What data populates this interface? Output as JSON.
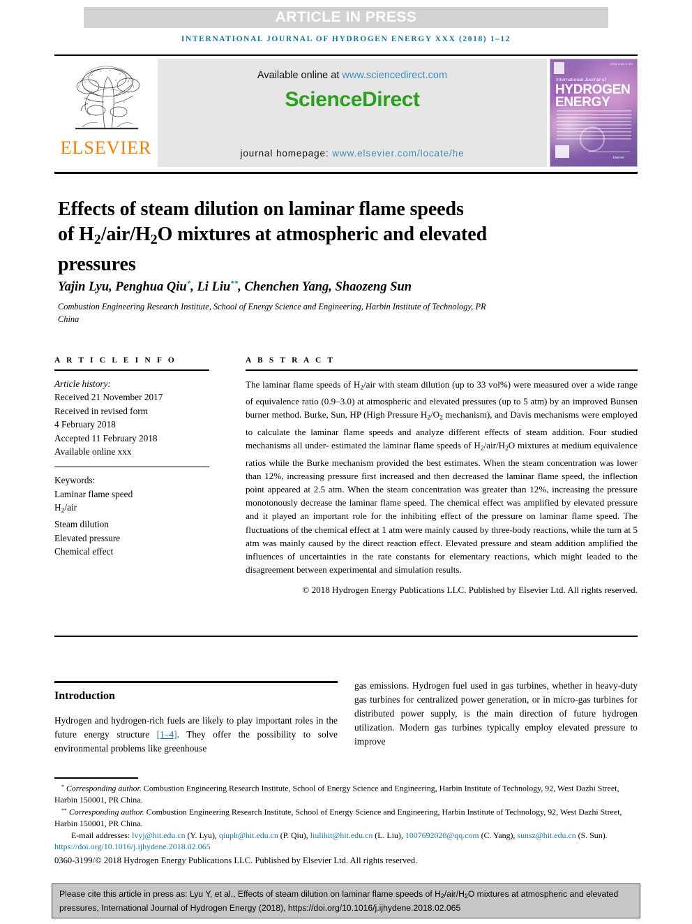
{
  "banner": {
    "label": "ARTICLE IN PRESS"
  },
  "running_head": "INTERNATIONAL JOURNAL OF HYDROGEN ENERGY XXX (2018) 1–12",
  "masthead": {
    "publisher": "ELSEVIER",
    "available_prefix": "Available online at ",
    "available_url": "www.sciencedirect.com",
    "sciencedirect_logo": "ScienceDirect",
    "homepage_prefix": "journal homepage: ",
    "homepage_url": "www.elsevier.com/locate/he",
    "cover": {
      "overline": "International Journal of",
      "title_line1": "HYDROGEN",
      "title_line2": "ENERGY",
      "issn": "ISSN 0360-3199",
      "mark": "H2",
      "publisher_small": "Elsevier"
    }
  },
  "article": {
    "title_line1": "Effects of steam dilution on laminar flame speeds",
    "title_line2_a": "of H",
    "title_line2_sub1": "2",
    "title_line2_b": "/air/H",
    "title_line2_sub2": "2",
    "title_line2_c": "O mixtures at atmospheric and elevated",
    "title_line3": "pressures",
    "authors": "Yajin Lyu, Penghua Qiu",
    "authors_mid": ", Li Liu",
    "authors_end": ", Chenchen Yang, Shaozeng Sun",
    "corr_mark_1": "*",
    "corr_mark_2": "**",
    "affiliation": "Combustion Engineering Research Institute, School of Energy Science and Engineering, Harbin Institute of Technology, PR China"
  },
  "info": {
    "heading": "A R T I C L E   I N F O",
    "history_label": "Article history:",
    "history": [
      "Received 21 November 2017",
      "Received in revised form",
      "4 February 2018",
      "Accepted 11 February 2018",
      "Available online xxx"
    ],
    "keywords_label": "Keywords:",
    "keywords": [
      "Laminar flame speed",
      "H2/air",
      "Steam dilution",
      "Elevated pressure",
      "Chemical effect"
    ]
  },
  "abstract": {
    "heading": "A B S T R A C T",
    "text": "The laminar flame speeds of H2/air with steam dilution (up to 33 vol%) were measured over a wide range of equivalence ratio (0.9–3.0) at atmospheric and elevated pressures (up to 5 atm) by an improved Bunsen burner method. Burke, Sun, HP (High Pressure H2/O2 mechanism), and Davis mechanisms were employed to calculate the laminar flame speeds and analyze different effects of steam addition. Four studied mechanisms all underestimated the laminar flame speeds of H2/air/H2O mixtures at medium equivalence ratios while the Burke mechanism provided the best estimates. When the steam concentration was lower than 12%, increasing pressure first increased and then decreased the laminar flame speed, the inflection point appeared at 2.5 atm. When the steam concentration was greater than 12%, increasing the pressure monotonously decrease the laminar flame speed. The chemical effect was amplified by elevated pressure and it played an important role for the inhibiting effect of the pressure on laminar flame speed. The fluctuations of the chemical effect at 1 atm were mainly caused by three-body reactions, while the turn at 5 atm was mainly caused by the direct reaction effect. Elevated pressure and steam addition amplified the influences of uncertainties in the rate constants for elementary reactions, which might leaded to the disagreement between experimental and simulation results.",
    "copyright": "© 2018 Hydrogen Energy Publications LLC. Published by Elsevier Ltd. All rights reserved."
  },
  "body": {
    "intro_heading": "Introduction",
    "left_text_a": "Hydrogen and hydrogen-rich fuels are likely to play important roles in the future energy structure ",
    "left_ref": "[1–4]",
    "left_text_b": ". They offer the possibility to solve environmental problems like greenhouse",
    "right_text": "gas emissions. Hydrogen fuel used in gas turbines, whether in heavy-duty gas turbines for centralized power generation, or in micro-gas turbines for distributed power supply, is the main direction of future hydrogen utilization. Modern gas turbines typically employ elevated pressure to improve"
  },
  "footnotes": {
    "corr1_mark": "*",
    "corr1_label": "Corresponding author.",
    "corr1_text": " Combustion Engineering Research Institute, School of Energy Science and Engineering, Harbin Institute of Technology, 92, West Dazhi Street, Harbin 150001, PR China.",
    "corr2_mark": "**",
    "corr2_label": "Corresponding author.",
    "corr2_text": " Combustion Engineering Research Institute, School of Energy Science and Engineering, Harbin Institute of Technology, 92, West Dazhi Street, Harbin 150001, PR China.",
    "email_label": "E-mail addresses: ",
    "emails": [
      {
        "address": "lvyj@hit.edu.cn",
        "person": " (Y. Lyu), "
      },
      {
        "address": "qiuph@hit.edu.cn",
        "person": " (P. Qiu), "
      },
      {
        "address": "liulihit@hit.edu.cn",
        "person": " (L. Liu), "
      },
      {
        "address": "1007692028@qq.com",
        "person": " (C. Yang), "
      },
      {
        "address": "sunsz@hit.edu.cn",
        "person": " (S. Sun)."
      }
    ],
    "doi": "https://doi.org/10.1016/j.ijhydene.2018.02.065",
    "issn_line": "0360-3199/© 2018 Hydrogen Energy Publications LLC. Published by Elsevier Ltd. All rights reserved."
  },
  "cite_box": {
    "line1_a": "Please cite this article in press as: Lyu Y, et al., Effects of steam dilution on laminar flame speeds of H",
    "sub1": "2",
    "line1_b": "/air/H",
    "sub2": "2",
    "line1_c": "O mixtures at atmospheric",
    "line2": "and elevated pressures, International Journal of Hydrogen Energy (2018), https://doi.org/10.1016/j.ijhydene.2018.02.065"
  },
  "colors": {
    "link": "#1a7599",
    "sciencedirect_green": "#2aa01e",
    "elsevier_orange": "#f07d00",
    "banner_gray": "#d2d2d2",
    "cite_gray": "#c6c6c6"
  }
}
